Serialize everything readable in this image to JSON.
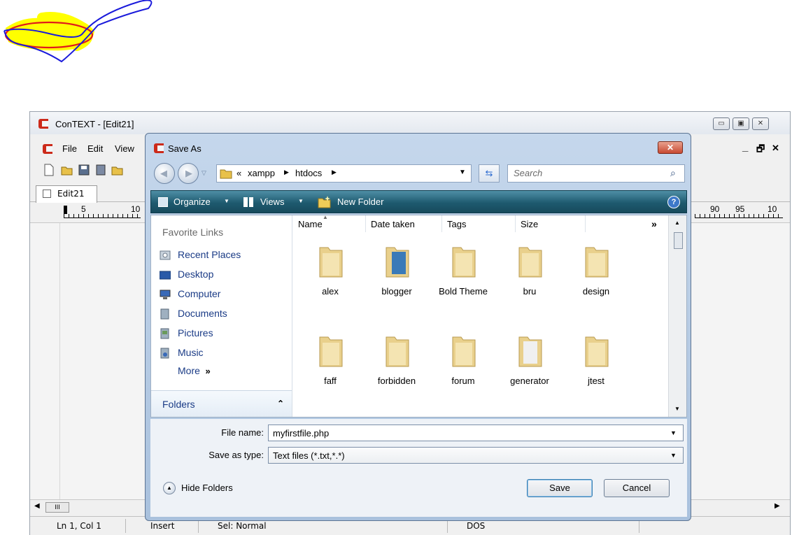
{
  "doodle": {
    "highlight_color": "#ffff00",
    "stroke_blue": "#1a1adb",
    "stroke_red": "#e01b1b"
  },
  "app": {
    "title": "ConTEXT - [Edit21]",
    "menu": [
      "File",
      "Edit",
      "View"
    ],
    "tab_label": "Edit21",
    "ruler_left": [
      "5",
      "10"
    ],
    "ruler_right": [
      "90",
      "95",
      "10"
    ],
    "hscroll_thumb": "III",
    "status": {
      "position": "Ln 1, Col 1",
      "mode": "Insert",
      "sel": "Sel: Normal",
      "format": "DOS"
    },
    "brand_color": "#cc2a1a"
  },
  "dialog": {
    "title": "Save As",
    "breadcrumb": {
      "prefix": "«",
      "items": [
        "xampp",
        "htdocs"
      ]
    },
    "search_placeholder": "Search",
    "commands": {
      "organize": "Organize",
      "views": "Views",
      "new_folder": "New Folder"
    },
    "favorite_links_title": "Favorite Links",
    "favorite_links": [
      {
        "label": "Recent Places",
        "icon": "recent-places-icon"
      },
      {
        "label": "Desktop",
        "icon": "desktop-icon"
      },
      {
        "label": "Computer",
        "icon": "computer-icon"
      },
      {
        "label": "Documents",
        "icon": "documents-icon"
      },
      {
        "label": "Pictures",
        "icon": "pictures-icon"
      },
      {
        "label": "Music",
        "icon": "music-icon"
      }
    ],
    "more_label": "More",
    "folders_label": "Folders",
    "columns": [
      "Name",
      "Date taken",
      "Tags",
      "Size"
    ],
    "folders": [
      "alex",
      "blogger",
      "Bold Theme",
      "bru",
      "design",
      "faff",
      "forbidden",
      "forum",
      "generator",
      "jtest"
    ],
    "file_name_label": "File name:",
    "file_name_value": "myfirstfile.php",
    "save_type_label": "Save as type:",
    "save_type_value": "Text files (*.txt,*.*)",
    "hide_folders_label": "Hide Folders",
    "save_label": "Save",
    "cancel_label": "Cancel",
    "command_bar_color": "#1e5a6f",
    "link_color": "#1a3b86"
  }
}
